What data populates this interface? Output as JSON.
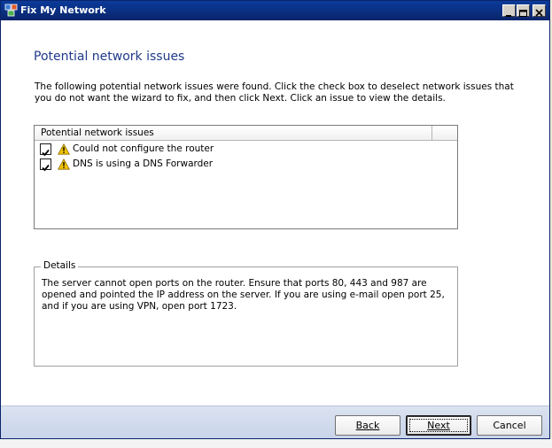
{
  "window": {
    "title": "Fix My Network"
  },
  "page": {
    "heading": "Potential network issues",
    "intro": "The following potential network issues were found. Click the check box to deselect network issues that you do not want the wizard to fix, and then click Next. Click an issue to view the details."
  },
  "issues": {
    "header": "Potential network issues",
    "items": [
      {
        "label": "Could not configure the router",
        "checked": true,
        "icon": "warning-icon"
      },
      {
        "label": "DNS is using a DNS Forwarder",
        "checked": true,
        "icon": "warning-icon"
      }
    ]
  },
  "details": {
    "legend": "Details",
    "text": "The server cannot open ports on the router. Ensure that ports 80, 443 and 987 are opened and pointed the IP address on the server. If you are using e-mail open port 25, and if you are using VPN, open port 1723."
  },
  "buttons": {
    "back": "Back",
    "next": "Next",
    "cancel": "Cancel"
  },
  "colors": {
    "heading": "#1f3a8a",
    "titlebar": "#0a246a",
    "button_bar": "#c9d4ea"
  }
}
